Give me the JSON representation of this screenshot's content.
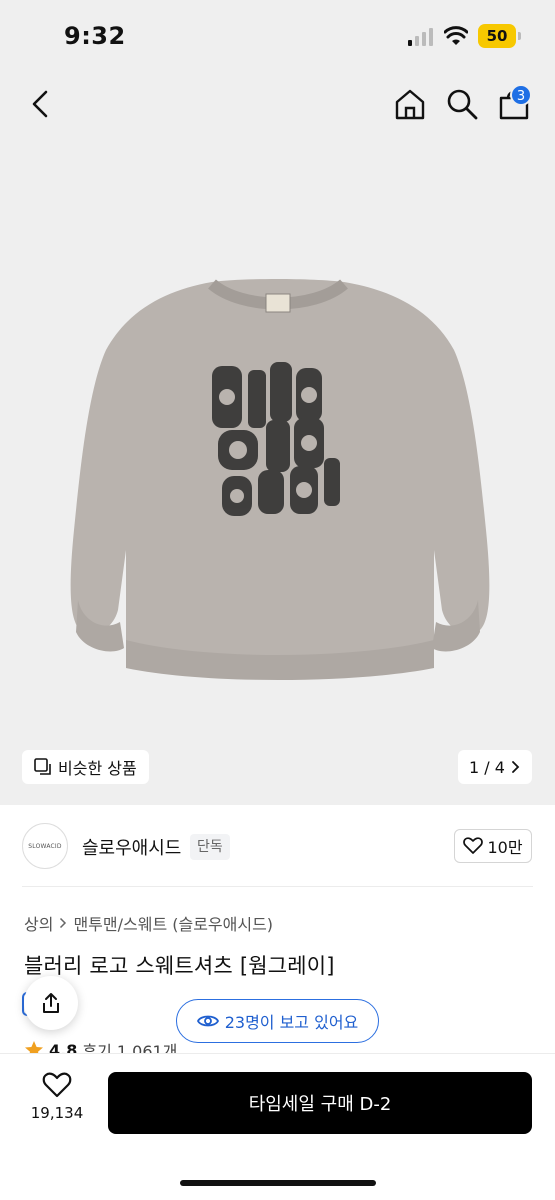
{
  "status_bar": {
    "time": "9:32",
    "battery": "50"
  },
  "nav": {
    "cart_count": "3"
  },
  "gallery": {
    "similar_label": "비슷한 상품",
    "pager": "1 / 4"
  },
  "brand": {
    "logo_text": "SLOWACID",
    "name": "슬로우애시드",
    "tag": "단독",
    "likes": "10만"
  },
  "breadcrumb": [
    "상의",
    "맨투맨/스웨트 (슬로우애시드)"
  ],
  "product": {
    "title": "블러리 로고 스웨트셔츠 [웜그레이]",
    "rating": "4.8",
    "reviews": "후기 1,061개"
  },
  "viewers": "23명이 보고 있어요",
  "bottom": {
    "wish_count": "19,134",
    "buy_label": "타임세일 구매 D-2"
  },
  "colors": {
    "accent": "#2c6fe0",
    "battery": "#f7c800",
    "star": "#f0a020",
    "garment": "#b9b3ae"
  },
  "icons": [
    "back-icon",
    "home-icon",
    "search-icon",
    "cart-icon",
    "similar-icon",
    "chevron-right-icon",
    "heart-icon",
    "share-icon",
    "eye-icon",
    "star-icon"
  ]
}
